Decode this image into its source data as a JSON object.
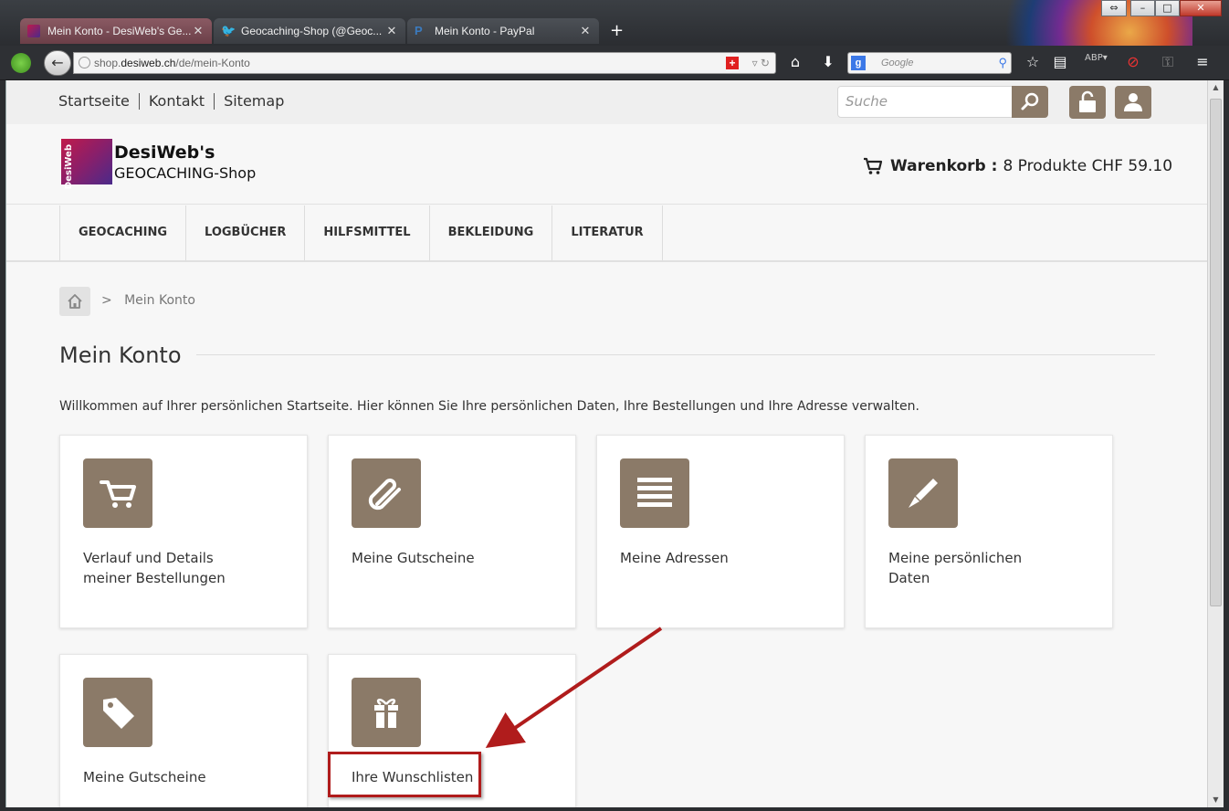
{
  "browser": {
    "tabs": [
      {
        "label": "Mein Konto - DesiWeb's Ge...",
        "active": true
      },
      {
        "label": "Geocaching-Shop (@Geoc...",
        "active": false
      },
      {
        "label": "Mein Konto - PayPal",
        "active": false
      }
    ],
    "url_prefix": "shop.",
    "url_host": "desiweb.ch",
    "url_path": "/de/mein-Konto",
    "search_engine_placeholder": "Google"
  },
  "topbar": {
    "links": [
      "Startseite",
      "Kontakt",
      "Sitemap"
    ],
    "search_placeholder": "Suche"
  },
  "header": {
    "logo_title": "DesiWeb's",
    "logo_subtitle": "GEOCACHING-Shop",
    "logo_mark_text": "DesiWeb",
    "cart_label": "Warenkorb :",
    "cart_summary": "8 Produkte CHF 59.10"
  },
  "mainnav": {
    "items": [
      "GEOCACHING",
      "LOGBÜCHER",
      "HILFSMITTEL",
      "BEKLEIDUNG",
      "LITERATUR"
    ]
  },
  "breadcrumb": {
    "separator": ">",
    "current": "Mein Konto"
  },
  "page": {
    "title": "Mein Konto",
    "welcome": "Willkommen auf Ihrer persönlichen Startseite. Hier können Sie Ihre persönlichen Daten, Ihre Bestellungen und Ihre Adresse verwalten."
  },
  "tiles": [
    {
      "icon": "cart-icon",
      "line1": "Verlauf und Details",
      "line2": "meiner Bestellungen"
    },
    {
      "icon": "paperclip-icon",
      "line1": "Meine Gutscheine",
      "line2": ""
    },
    {
      "icon": "list-icon",
      "line1": "Meine Adressen",
      "line2": ""
    },
    {
      "icon": "pencil-icon",
      "line1": "Meine persönlichen",
      "line2": "Daten"
    },
    {
      "icon": "tag-icon",
      "line1": "Meine Gutscheine",
      "line2": ""
    },
    {
      "icon": "gift-icon",
      "line1": "Ihre Wunschlisten",
      "line2": ""
    }
  ],
  "colors": {
    "accent": "#8b7a68",
    "annotation": "#b01c1c"
  }
}
